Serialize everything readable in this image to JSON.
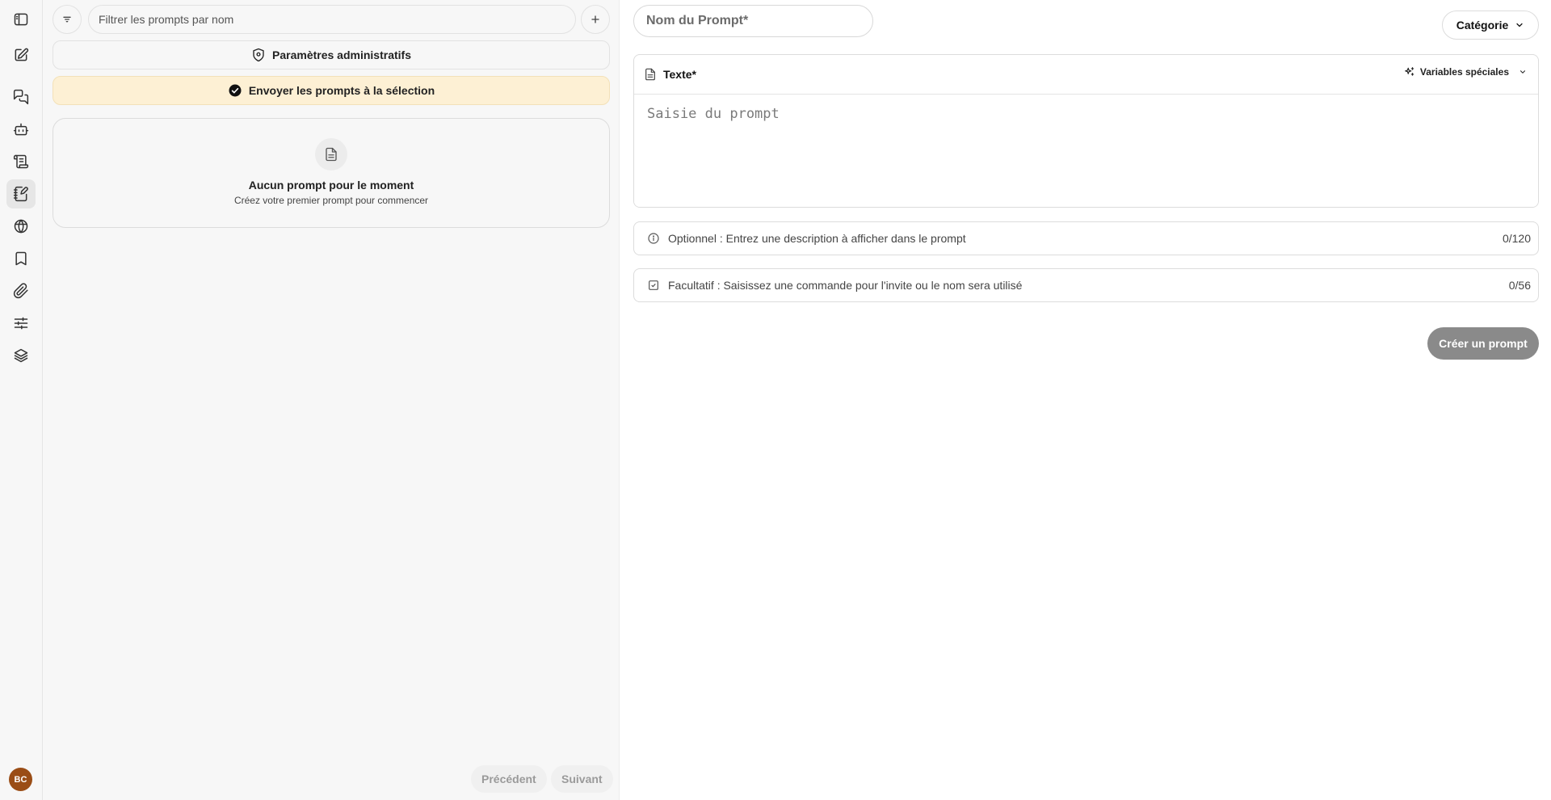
{
  "rail": {
    "items": [
      {
        "icon": "sidebar-toggle-icon"
      },
      {
        "icon": "new-chat-icon"
      },
      {
        "icon": "chats-icon"
      },
      {
        "icon": "agents-icon"
      },
      {
        "icon": "bookmarks-list-icon"
      },
      {
        "icon": "prompts-icon",
        "active": true
      },
      {
        "icon": "web-search-icon"
      },
      {
        "icon": "bookmark-icon"
      },
      {
        "icon": "attachment-icon"
      },
      {
        "icon": "settings-sliders-icon"
      },
      {
        "icon": "memory-icon"
      }
    ],
    "avatar_initials": "BC",
    "avatar_color": "#9a4d16"
  },
  "panel": {
    "filter_placeholder": "Filtrer les prompts par nom",
    "admin_label": "Paramètres administratifs",
    "send_label": "Envoyer les prompts à la sélection",
    "empty_title": "Aucun prompt pour le moment",
    "empty_subtitle": "Créez votre premier prompt pour commencer",
    "prev_label": "Précédent",
    "next_label": "Suivant"
  },
  "form": {
    "name_placeholder": "Nom du Prompt*",
    "category_label": "Catégorie",
    "text_label": "Texte*",
    "variables_label": "Variables spéciales",
    "prompt_placeholder": "Saisie du prompt",
    "description_placeholder": "Optionnel : Entrez une description à afficher dans le prompt",
    "description_count": "0/120",
    "command_placeholder": "Facultatif : Saisissez une commande pour l'invite ou le nom sera utilisé",
    "command_count": "0/56",
    "create_label": "Créer un prompt"
  },
  "colors": {
    "send_bar_bg": "#fdf0d4",
    "create_button_bg": "#8a8a8a"
  }
}
